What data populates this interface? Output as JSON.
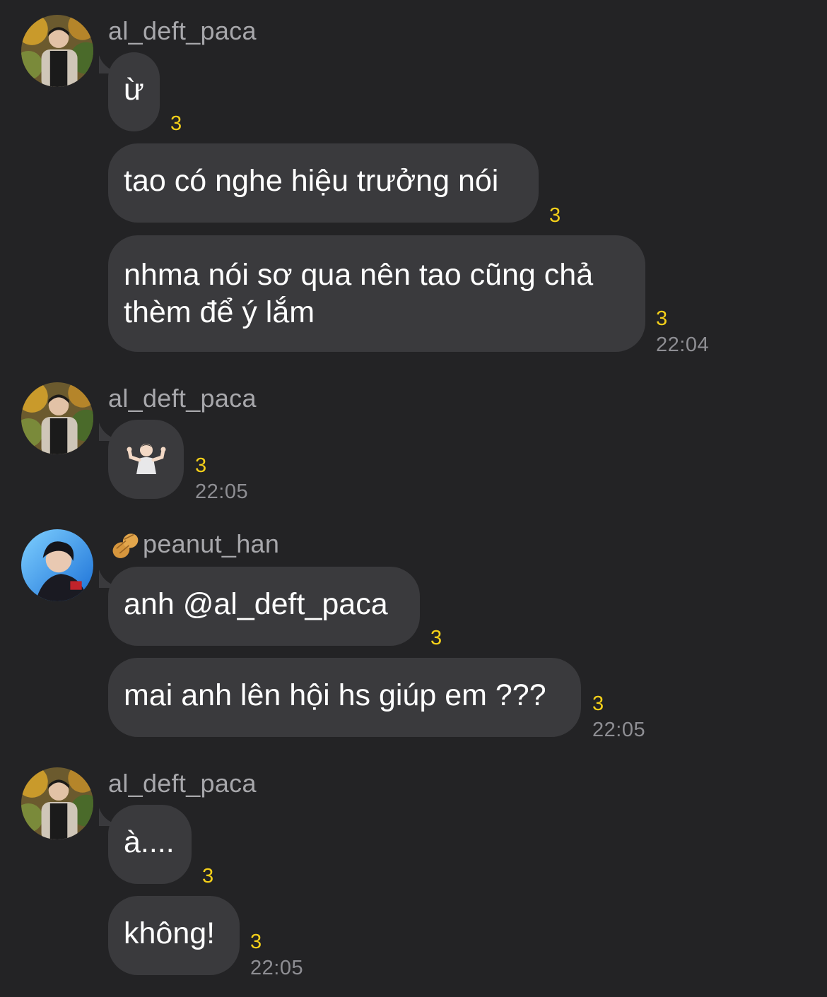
{
  "colors": {
    "background": "#232325",
    "bubble": "#3a3a3d",
    "count": "#f5d019",
    "name": "#a7a7ab",
    "time": "#8e8e93"
  },
  "groups": [
    {
      "username": "al_deft_paca",
      "messages": [
        {
          "text": "ừ",
          "count": "3"
        },
        {
          "text": "tao có nghe hiệu trưởng nói",
          "count": "3"
        },
        {
          "text": "nhma nói sơ qua nên tao cũng chả thèm để ý lắm",
          "count": "3"
        }
      ],
      "time": "22:04"
    },
    {
      "username": "al_deft_paca",
      "messages": [
        {
          "text": "",
          "icon": "person-shrugging-emoji",
          "count": "3"
        }
      ],
      "time": "22:05"
    },
    {
      "username": "peanut_han",
      "badge_icon": "peanut-emoji",
      "messages": [
        {
          "text": "anh @al_deft_paca",
          "count": "3"
        },
        {
          "text": "mai anh lên hội hs giúp em ???",
          "count": "3"
        }
      ],
      "time": "22:05"
    },
    {
      "username": "al_deft_paca",
      "messages": [
        {
          "text": "à....",
          "count": "3"
        },
        {
          "text": "không!",
          "count": "3"
        }
      ],
      "time": "22:05"
    }
  ]
}
